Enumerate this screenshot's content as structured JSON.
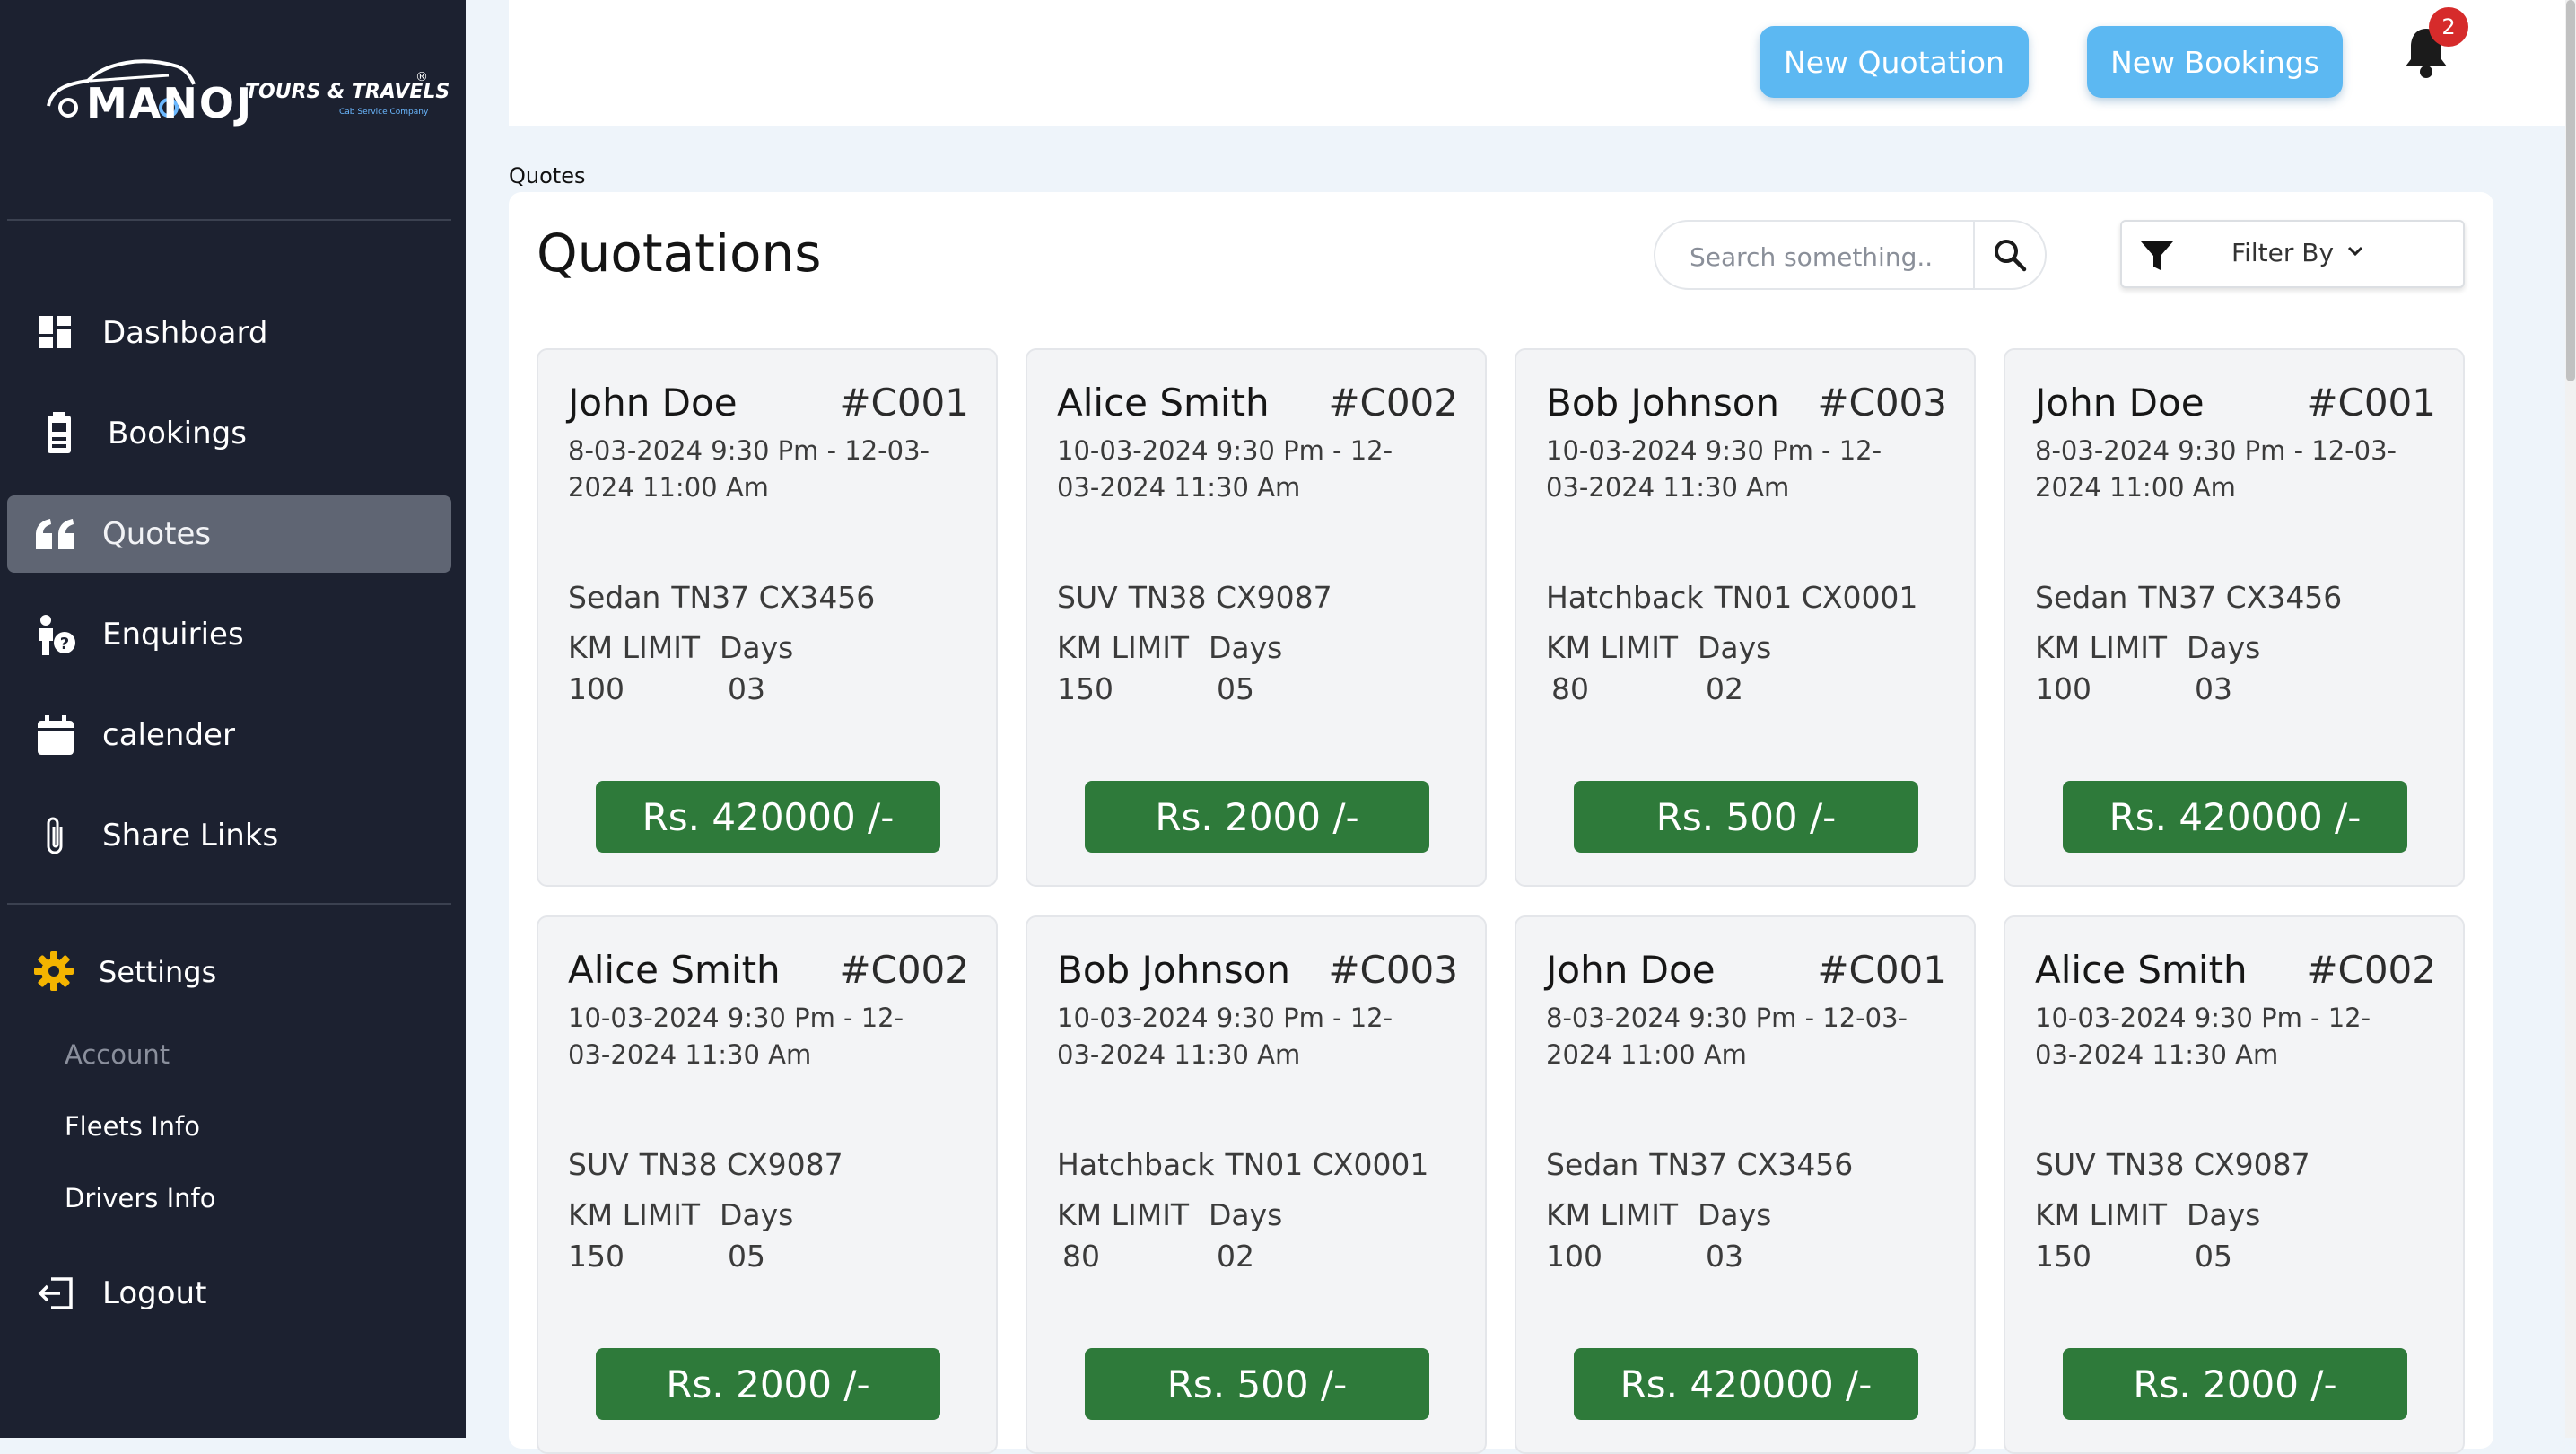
{
  "brand": {
    "name": "MANOJ",
    "tagline_main": "TOURS & TRAVELS",
    "tagline_sub": "Cab Service Company",
    "registered": "®"
  },
  "sidebar": {
    "items": [
      {
        "label": "Dashboard",
        "icon": "dashboard-icon"
      },
      {
        "label": "Bookings",
        "icon": "bookings-icon"
      },
      {
        "label": "Quotes",
        "icon": "quote-icon",
        "active": true
      },
      {
        "label": "Enquiries",
        "icon": "enquiry-icon"
      },
      {
        "label": "calender",
        "icon": "calendar-icon"
      },
      {
        "label": "Share Links",
        "icon": "paperclip-icon"
      }
    ],
    "settings": {
      "label": "Settings",
      "icon": "gear-icon"
    },
    "account_heading": "Account",
    "account_items": [
      "Fleets Info",
      "Drivers Info"
    ],
    "logout": "Logout"
  },
  "topbar": {
    "new_quotation": "New Quotation",
    "new_bookings": "New Bookings",
    "notification_count": "2"
  },
  "breadcrumb": "Quotes",
  "main": {
    "title": "Quotations",
    "search_placeholder": "Search something..",
    "filter_label": "Filter By"
  },
  "colors": {
    "sidebar_bg": "#1c2130",
    "active_item": "#5f6573",
    "accent_button": "#5cb8f2",
    "price_button": "#2e7a3a",
    "badge": "#d62b2b"
  },
  "cards": [
    {
      "name": "John Doe",
      "id": "#C001",
      "dates": "8-03-2024 9:30 Pm - 12-03-2024 11:00 Am",
      "vehicle": "Sedan",
      "plate": "TN37 CX3456",
      "km_label": "KM LIMIT",
      "days_label": "Days",
      "km": "100",
      "days": "03",
      "price": "Rs. 420000 /-"
    },
    {
      "name": "Alice Smith",
      "id": "#C002",
      "dates": "10-03-2024 9:30 Pm - 12-03-2024 11:30 Am",
      "vehicle": "SUV",
      "plate": "TN38 CX9087",
      "km_label": "KM LIMIT",
      "days_label": "Days",
      "km": "150",
      "days": "05",
      "price": "Rs. 2000 /-"
    },
    {
      "name": "Bob Johnson",
      "id": "#C003",
      "dates": "10-03-2024 9:30 Pm - 12-03-2024 11:30 Am",
      "vehicle": "Hatchback",
      "plate": "TN01 CX0001",
      "km_label": "KM LIMIT",
      "days_label": "Days",
      "km": "80",
      "days": "02",
      "price": "Rs. 500 /-"
    },
    {
      "name": "John Doe",
      "id": "#C001",
      "dates": "8-03-2024 9:30 Pm - 12-03-2024 11:00 Am",
      "vehicle": "Sedan",
      "plate": "TN37 CX3456",
      "km_label": "KM LIMIT",
      "days_label": "Days",
      "km": "100",
      "days": "03",
      "price": "Rs. 420000 /-"
    },
    {
      "name": "Alice Smith",
      "id": "#C002",
      "dates": "10-03-2024 9:30 Pm - 12-03-2024 11:30 Am",
      "vehicle": "SUV",
      "plate": "TN38 CX9087",
      "km_label": "KM LIMIT",
      "days_label": "Days",
      "km": "150",
      "days": "05",
      "price": "Rs. 2000 /-"
    },
    {
      "name": "Bob Johnson",
      "id": "#C003",
      "dates": "10-03-2024 9:30 Pm - 12-03-2024 11:30 Am",
      "vehicle": "Hatchback",
      "plate": "TN01 CX0001",
      "km_label": "KM LIMIT",
      "days_label": "Days",
      "km": "80",
      "days": "02",
      "price": "Rs. 500 /-"
    },
    {
      "name": "John Doe",
      "id": "#C001",
      "dates": "8-03-2024 9:30 Pm - 12-03-2024 11:00 Am",
      "vehicle": "Sedan",
      "plate": "TN37 CX3456",
      "km_label": "KM LIMIT",
      "days_label": "Days",
      "km": "100",
      "days": "03",
      "price": "Rs. 420000 /-"
    },
    {
      "name": "Alice Smith",
      "id": "#C002",
      "dates": "10-03-2024 9:30 Pm - 12-03-2024 11:30 Am",
      "vehicle": "SUV",
      "plate": "TN38 CX9087",
      "km_label": "KM LIMIT",
      "days_label": "Days",
      "km": "150",
      "days": "05",
      "price": "Rs. 2000 /-"
    }
  ]
}
